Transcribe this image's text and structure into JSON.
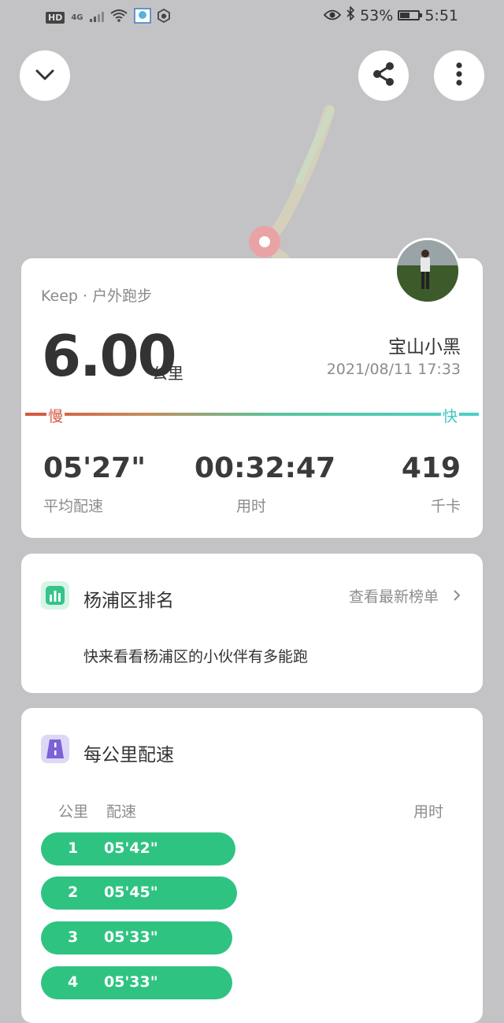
{
  "status_bar": {
    "left": {
      "hd": "HD",
      "signal": "4G"
    },
    "right": {
      "battery_text": "53%",
      "battery_level": 0.53,
      "time": "5:51"
    }
  },
  "icons": {
    "collapse": "chevron-down-icon",
    "share": "share-icon",
    "more": "more-vertical-icon",
    "rank": "bar-chart-icon",
    "pace": "road-icon"
  },
  "workout": {
    "source": "Keep · 户外跑步",
    "distance": "6.00",
    "distance_unit": "公里",
    "username": "宝山小黑",
    "datetime": "2021/08/11 17:33",
    "slow_label": "慢",
    "fast_label": "快",
    "stats": [
      {
        "value": "05'27\"",
        "label": "平均配速"
      },
      {
        "value": "00:32:47",
        "label": "用时"
      },
      {
        "value": "419",
        "label": "千卡"
      }
    ]
  },
  "ranking": {
    "title": "杨浦区排名",
    "link": "查看最新榜单",
    "description": "快来看看杨浦区的小伙伴有多能跑"
  },
  "splits": {
    "title": "每公里配速",
    "columns": {
      "km": "公里",
      "pace": "配速",
      "time": "用时"
    },
    "rows": [
      {
        "km": "1",
        "pace": "05'42\""
      },
      {
        "km": "2",
        "pace": "05'45\""
      },
      {
        "km": "3",
        "pace": "05'33\""
      },
      {
        "km": "4",
        "pace": "05'33\""
      }
    ]
  },
  "colors": {
    "accent_green": "#2fc382",
    "slow_red": "#d4573f",
    "fast_cyan": "#3cc7c2",
    "background": "#c3c3c5"
  }
}
